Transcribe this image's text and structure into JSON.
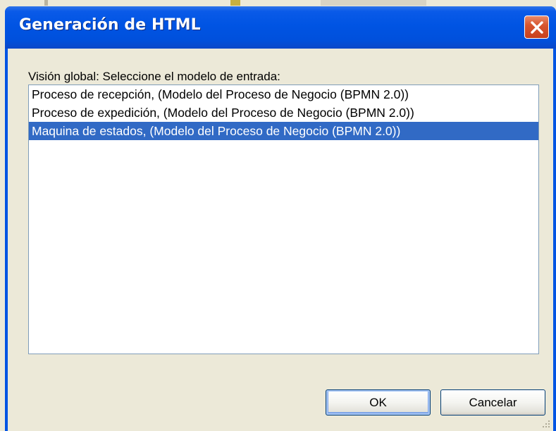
{
  "window": {
    "title": "Generación de HTML",
    "close_icon": "close-x-icon"
  },
  "dialog": {
    "prompt": "Visión global: Seleccione el modelo de entrada:",
    "items": [
      {
        "label": "Proceso de recepción, (Modelo del Proceso de Negocio (BPMN 2.0))",
        "selected": false
      },
      {
        "label": "Proceso de expedición, (Modelo del Proceso de Negocio (BPMN 2.0))",
        "selected": false
      },
      {
        "label": "Maquina de estados, (Modelo del Proceso de Negocio (BPMN 2.0))",
        "selected": true
      }
    ],
    "ok_label": "OK",
    "cancel_label": "Cancelar"
  },
  "colors": {
    "titlebar": "#0054e3",
    "selection": "#316ac5",
    "close_button": "#d8562f",
    "face": "#ece9d8"
  }
}
